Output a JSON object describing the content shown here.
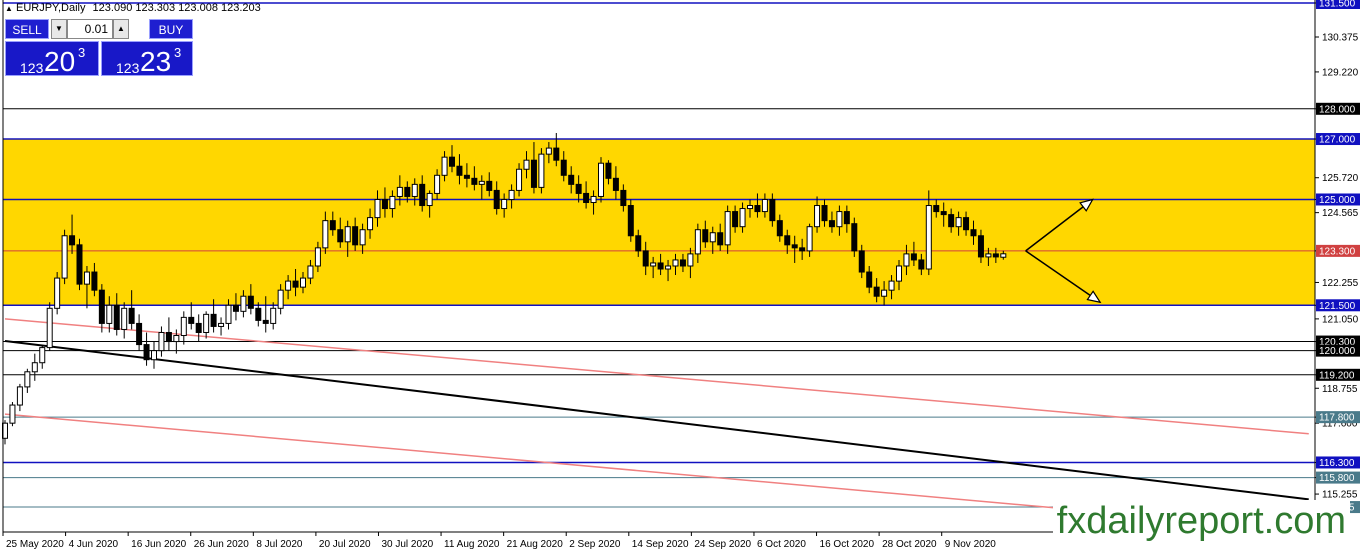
{
  "header": {
    "symbol": "EURJPY,Daily",
    "ohlc": "123.090 123.303 123.008 123.203"
  },
  "trade_panel": {
    "sell_label": "SELL",
    "buy_label": "BUY",
    "lot": "0.01",
    "sell_small": "123",
    "sell_big": "20",
    "sell_sup": "3",
    "buy_small": "123",
    "buy_big": "23",
    "buy_sup": "3"
  },
  "watermark": "fxdailyreport.com",
  "colors": {
    "zone": "#ffd700",
    "blue_line": "#1010c0",
    "black_line": "#000000",
    "teal_line": "#4a7a8a",
    "red_line": "#d04040",
    "pink_line": "#f08080",
    "bull": "#ffffff",
    "bear": "#000000"
  },
  "chart_data": {
    "type": "candlestick",
    "symbol": "EURJPY",
    "timeframe": "Daily",
    "ylim": [
      114.0,
      131.5
    ],
    "y_ticks": [
      "131.500",
      "130.375",
      "129.220",
      "128.000",
      "127.000",
      "125.720",
      "125.000",
      "124.565",
      "123.300",
      "122.255",
      "121.500",
      "121.050",
      "120.300",
      "120.000",
      "119.200",
      "118.755",
      "117.800",
      "117.600",
      "116.300",
      "115.800",
      "115.255",
      "114.825"
    ],
    "x_labels": [
      "25 May 2020",
      "4 Jun 2020",
      "16 Jun 2020",
      "26 Jun 2020",
      "8 Jul 2020",
      "20 Jul 2020",
      "30 Jul 2020",
      "11 Aug 2020",
      "21 Aug 2020",
      "2 Sep 2020",
      "14 Sep 2020",
      "24 Sep 2020",
      "6 Oct 2020",
      "16 Oct 2020",
      "28 Oct 2020",
      "9 Nov 2020"
    ],
    "zones": [
      {
        "from": 125.0,
        "to": 127.0
      },
      {
        "from": 121.5,
        "to": 125.0
      }
    ],
    "horizontal_levels": [
      {
        "price": 131.5,
        "label": "131.500",
        "style": "blue"
      },
      {
        "price": 128.0,
        "label": "128.000",
        "style": "black"
      },
      {
        "price": 127.0,
        "label": "127.000",
        "style": "blue"
      },
      {
        "price": 125.0,
        "label": "125.000",
        "style": "blue"
      },
      {
        "price": 123.3,
        "label": "123.300",
        "style": "red"
      },
      {
        "price": 121.5,
        "label": "121.500",
        "style": "blue"
      },
      {
        "price": 120.3,
        "label": "120.300",
        "style": "black"
      },
      {
        "price": 120.0,
        "label": "120.000",
        "style": "black"
      },
      {
        "price": 119.2,
        "label": "119.200",
        "style": "black"
      },
      {
        "price": 117.8,
        "label": "117.800",
        "style": "teal"
      },
      {
        "price": 116.3,
        "label": "116.300",
        "style": "blue"
      },
      {
        "price": 115.8,
        "label": "115.800",
        "style": "teal"
      },
      {
        "price": 114.825,
        "label": "114.825",
        "style": "teal"
      }
    ],
    "trendlines": [
      {
        "style": "black",
        "from": {
          "bar": 0,
          "price": 120.32
        },
        "to": {
          "bar": 175,
          "price": 115.08
        }
      },
      {
        "style": "pink",
        "from": {
          "bar": 0,
          "price": 121.05
        },
        "to": {
          "bar": 175,
          "price": 117.25
        }
      },
      {
        "style": "pink",
        "from": {
          "bar": 0,
          "price": 117.9
        },
        "to": {
          "bar": 175,
          "price": 114.05
        }
      }
    ],
    "arrows": [
      {
        "from": {
          "bar": 137,
          "price": 123.3
        },
        "to": {
          "bar": 146,
          "price": 125.0
        }
      },
      {
        "from": {
          "bar": 137,
          "price": 123.3
        },
        "to": {
          "bar": 147,
          "price": 121.6
        }
      }
    ],
    "candles": [
      [
        117.1,
        117.7,
        116.9,
        117.6
      ],
      [
        117.6,
        118.3,
        117.5,
        118.2
      ],
      [
        118.2,
        118.9,
        118.0,
        118.8
      ],
      [
        118.8,
        119.4,
        118.6,
        119.3
      ],
      [
        119.3,
        119.9,
        119.0,
        119.6
      ],
      [
        119.6,
        120.2,
        119.4,
        120.1
      ],
      [
        120.1,
        121.6,
        120.0,
        121.4
      ],
      [
        121.4,
        122.6,
        121.2,
        122.4
      ],
      [
        122.4,
        124.0,
        122.2,
        123.8
      ],
      [
        123.8,
        124.5,
        123.2,
        123.5
      ],
      [
        123.5,
        123.7,
        122.0,
        122.2
      ],
      [
        122.2,
        122.8,
        121.4,
        122.6
      ],
      [
        122.6,
        122.9,
        121.8,
        122.0
      ],
      [
        122.0,
        122.2,
        120.6,
        120.9
      ],
      [
        120.9,
        121.8,
        120.6,
        121.5
      ],
      [
        121.5,
        121.9,
        120.5,
        120.7
      ],
      [
        120.7,
        121.6,
        120.4,
        121.4
      ],
      [
        121.4,
        122.0,
        120.7,
        120.9
      ],
      [
        120.9,
        121.2,
        120.0,
        120.2
      ],
      [
        120.2,
        120.6,
        119.5,
        119.7
      ],
      [
        119.7,
        120.3,
        119.4,
        120.0
      ],
      [
        120.0,
        120.8,
        119.8,
        120.6
      ],
      [
        120.6,
        121.1,
        120.0,
        120.3
      ],
      [
        120.3,
        120.7,
        119.9,
        120.5
      ],
      [
        120.5,
        121.3,
        120.2,
        121.1
      ],
      [
        121.1,
        121.6,
        120.7,
        120.9
      ],
      [
        120.9,
        121.2,
        120.3,
        120.6
      ],
      [
        120.6,
        121.3,
        120.4,
        121.2
      ],
      [
        121.2,
        121.7,
        120.6,
        120.8
      ],
      [
        120.8,
        121.1,
        120.5,
        120.9
      ],
      [
        120.9,
        121.7,
        120.7,
        121.5
      ],
      [
        121.5,
        121.9,
        121.0,
        121.3
      ],
      [
        121.3,
        122.0,
        121.1,
        121.8
      ],
      [
        121.8,
        122.2,
        121.2,
        121.4
      ],
      [
        121.4,
        121.6,
        120.8,
        121.0
      ],
      [
        121.0,
        121.8,
        120.6,
        120.9
      ],
      [
        120.9,
        121.6,
        120.7,
        121.4
      ],
      [
        121.4,
        122.2,
        121.2,
        122.0
      ],
      [
        122.0,
        122.5,
        121.7,
        122.3
      ],
      [
        122.3,
        122.7,
        121.8,
        122.1
      ],
      [
        122.1,
        122.6,
        121.9,
        122.4
      ],
      [
        122.4,
        123.0,
        122.2,
        122.8
      ],
      [
        122.8,
        123.6,
        122.6,
        123.4
      ],
      [
        123.4,
        124.6,
        123.2,
        124.3
      ],
      [
        124.3,
        124.6,
        123.8,
        124.0
      ],
      [
        124.0,
        124.4,
        123.4,
        123.6
      ],
      [
        123.6,
        124.3,
        123.1,
        124.1
      ],
      [
        124.1,
        124.4,
        123.3,
        123.5
      ],
      [
        123.5,
        124.2,
        123.2,
        124.0
      ],
      [
        124.0,
        124.7,
        123.7,
        124.4
      ],
      [
        124.4,
        125.3,
        124.1,
        125.0
      ],
      [
        125.0,
        125.4,
        124.4,
        124.7
      ],
      [
        124.7,
        125.3,
        124.4,
        125.1
      ],
      [
        125.1,
        125.8,
        124.8,
        125.4
      ],
      [
        125.4,
        125.6,
        124.9,
        125.1
      ],
      [
        125.1,
        125.7,
        124.8,
        125.5
      ],
      [
        125.5,
        125.8,
        124.6,
        124.8
      ],
      [
        124.8,
        125.3,
        124.4,
        125.2
      ],
      [
        125.2,
        126.0,
        125.0,
        125.8
      ],
      [
        125.8,
        126.6,
        125.6,
        126.4
      ],
      [
        126.4,
        126.8,
        125.9,
        126.1
      ],
      [
        126.1,
        126.5,
        125.5,
        125.8
      ],
      [
        125.8,
        126.2,
        125.4,
        125.7
      ],
      [
        125.7,
        126.1,
        125.3,
        125.5
      ],
      [
        125.5,
        125.8,
        125.0,
        125.6
      ],
      [
        125.6,
        125.9,
        125.1,
        125.3
      ],
      [
        125.3,
        125.6,
        124.5,
        124.7
      ],
      [
        124.7,
        125.2,
        124.4,
        125.0
      ],
      [
        125.0,
        125.5,
        124.7,
        125.3
      ],
      [
        125.3,
        126.2,
        125.1,
        126.0
      ],
      [
        126.0,
        126.6,
        125.7,
        126.3
      ],
      [
        126.3,
        126.9,
        125.2,
        125.4
      ],
      [
        125.4,
        126.7,
        125.2,
        126.5
      ],
      [
        126.5,
        126.9,
        126.2,
        126.7
      ],
      [
        126.7,
        127.2,
        126.1,
        126.3
      ],
      [
        126.3,
        126.6,
        125.6,
        125.8
      ],
      [
        125.8,
        126.1,
        125.2,
        125.5
      ],
      [
        125.5,
        125.8,
        124.9,
        125.2
      ],
      [
        125.2,
        125.6,
        124.7,
        124.9
      ],
      [
        124.9,
        125.3,
        124.5,
        125.1
      ],
      [
        125.1,
        126.4,
        124.9,
        126.2
      ],
      [
        126.2,
        126.3,
        125.5,
        125.7
      ],
      [
        125.7,
        126.1,
        125.0,
        125.3
      ],
      [
        125.3,
        125.5,
        124.6,
        124.8
      ],
      [
        124.8,
        125.0,
        123.6,
        123.8
      ],
      [
        123.8,
        124.0,
        123.1,
        123.3
      ],
      [
        123.3,
        123.6,
        122.5,
        122.8
      ],
      [
        122.8,
        123.1,
        122.4,
        122.9
      ],
      [
        122.9,
        123.2,
        122.5,
        122.7
      ],
      [
        122.7,
        123.0,
        122.3,
        122.8
      ],
      [
        122.8,
        123.2,
        122.5,
        123.0
      ],
      [
        123.0,
        123.2,
        122.6,
        122.8
      ],
      [
        122.8,
        123.4,
        122.4,
        123.2
      ],
      [
        123.2,
        124.2,
        122.9,
        124.0
      ],
      [
        124.0,
        124.3,
        123.4,
        123.6
      ],
      [
        123.6,
        124.1,
        123.2,
        123.9
      ],
      [
        123.9,
        124.2,
        123.3,
        123.5
      ],
      [
        123.5,
        124.8,
        123.2,
        124.6
      ],
      [
        124.6,
        124.8,
        123.9,
        124.1
      ],
      [
        124.1,
        124.9,
        123.9,
        124.7
      ],
      [
        124.7,
        125.0,
        124.4,
        124.8
      ],
      [
        124.8,
        125.2,
        124.4,
        124.6
      ],
      [
        124.6,
        125.2,
        124.4,
        125.0
      ],
      [
        125.0,
        125.2,
        124.1,
        124.3
      ],
      [
        124.3,
        124.5,
        123.6,
        123.8
      ],
      [
        123.8,
        124.0,
        123.2,
        123.5
      ],
      [
        123.5,
        123.8,
        122.9,
        123.4
      ],
      [
        123.4,
        123.7,
        123.0,
        123.3
      ],
      [
        123.3,
        124.2,
        123.1,
        124.1
      ],
      [
        124.1,
        125.1,
        123.9,
        124.8
      ],
      [
        124.8,
        125.0,
        124.1,
        124.3
      ],
      [
        124.3,
        124.6,
        123.9,
        124.1
      ],
      [
        124.1,
        124.8,
        123.8,
        124.6
      ],
      [
        124.6,
        124.8,
        123.9,
        124.2
      ],
      [
        124.2,
        124.4,
        123.1,
        123.3
      ],
      [
        123.3,
        123.5,
        122.4,
        122.6
      ],
      [
        122.6,
        122.8,
        121.9,
        122.1
      ],
      [
        122.1,
        122.4,
        121.6,
        121.8
      ],
      [
        121.8,
        122.3,
        121.5,
        122.0
      ],
      [
        122.0,
        122.5,
        121.7,
        122.3
      ],
      [
        122.3,
        123.0,
        122.0,
        122.8
      ],
      [
        122.8,
        123.5,
        122.5,
        123.2
      ],
      [
        123.2,
        123.6,
        122.8,
        123.0
      ],
      [
        123.0,
        123.2,
        122.5,
        122.7
      ],
      [
        122.7,
        125.3,
        122.5,
        124.8
      ],
      [
        124.8,
        125.0,
        124.4,
        124.6
      ],
      [
        124.6,
        124.9,
        124.1,
        124.5
      ],
      [
        124.5,
        124.7,
        123.9,
        124.1
      ],
      [
        124.1,
        124.6,
        123.8,
        124.4
      ],
      [
        124.4,
        124.6,
        123.8,
        124.0
      ],
      [
        124.0,
        124.3,
        123.5,
        123.8
      ],
      [
        123.8,
        124.0,
        122.9,
        123.1
      ],
      [
        123.1,
        123.4,
        122.8,
        123.2
      ],
      [
        123.2,
        123.4,
        122.9,
        123.1
      ],
      [
        123.09,
        123.303,
        123.008,
        123.203
      ]
    ]
  }
}
